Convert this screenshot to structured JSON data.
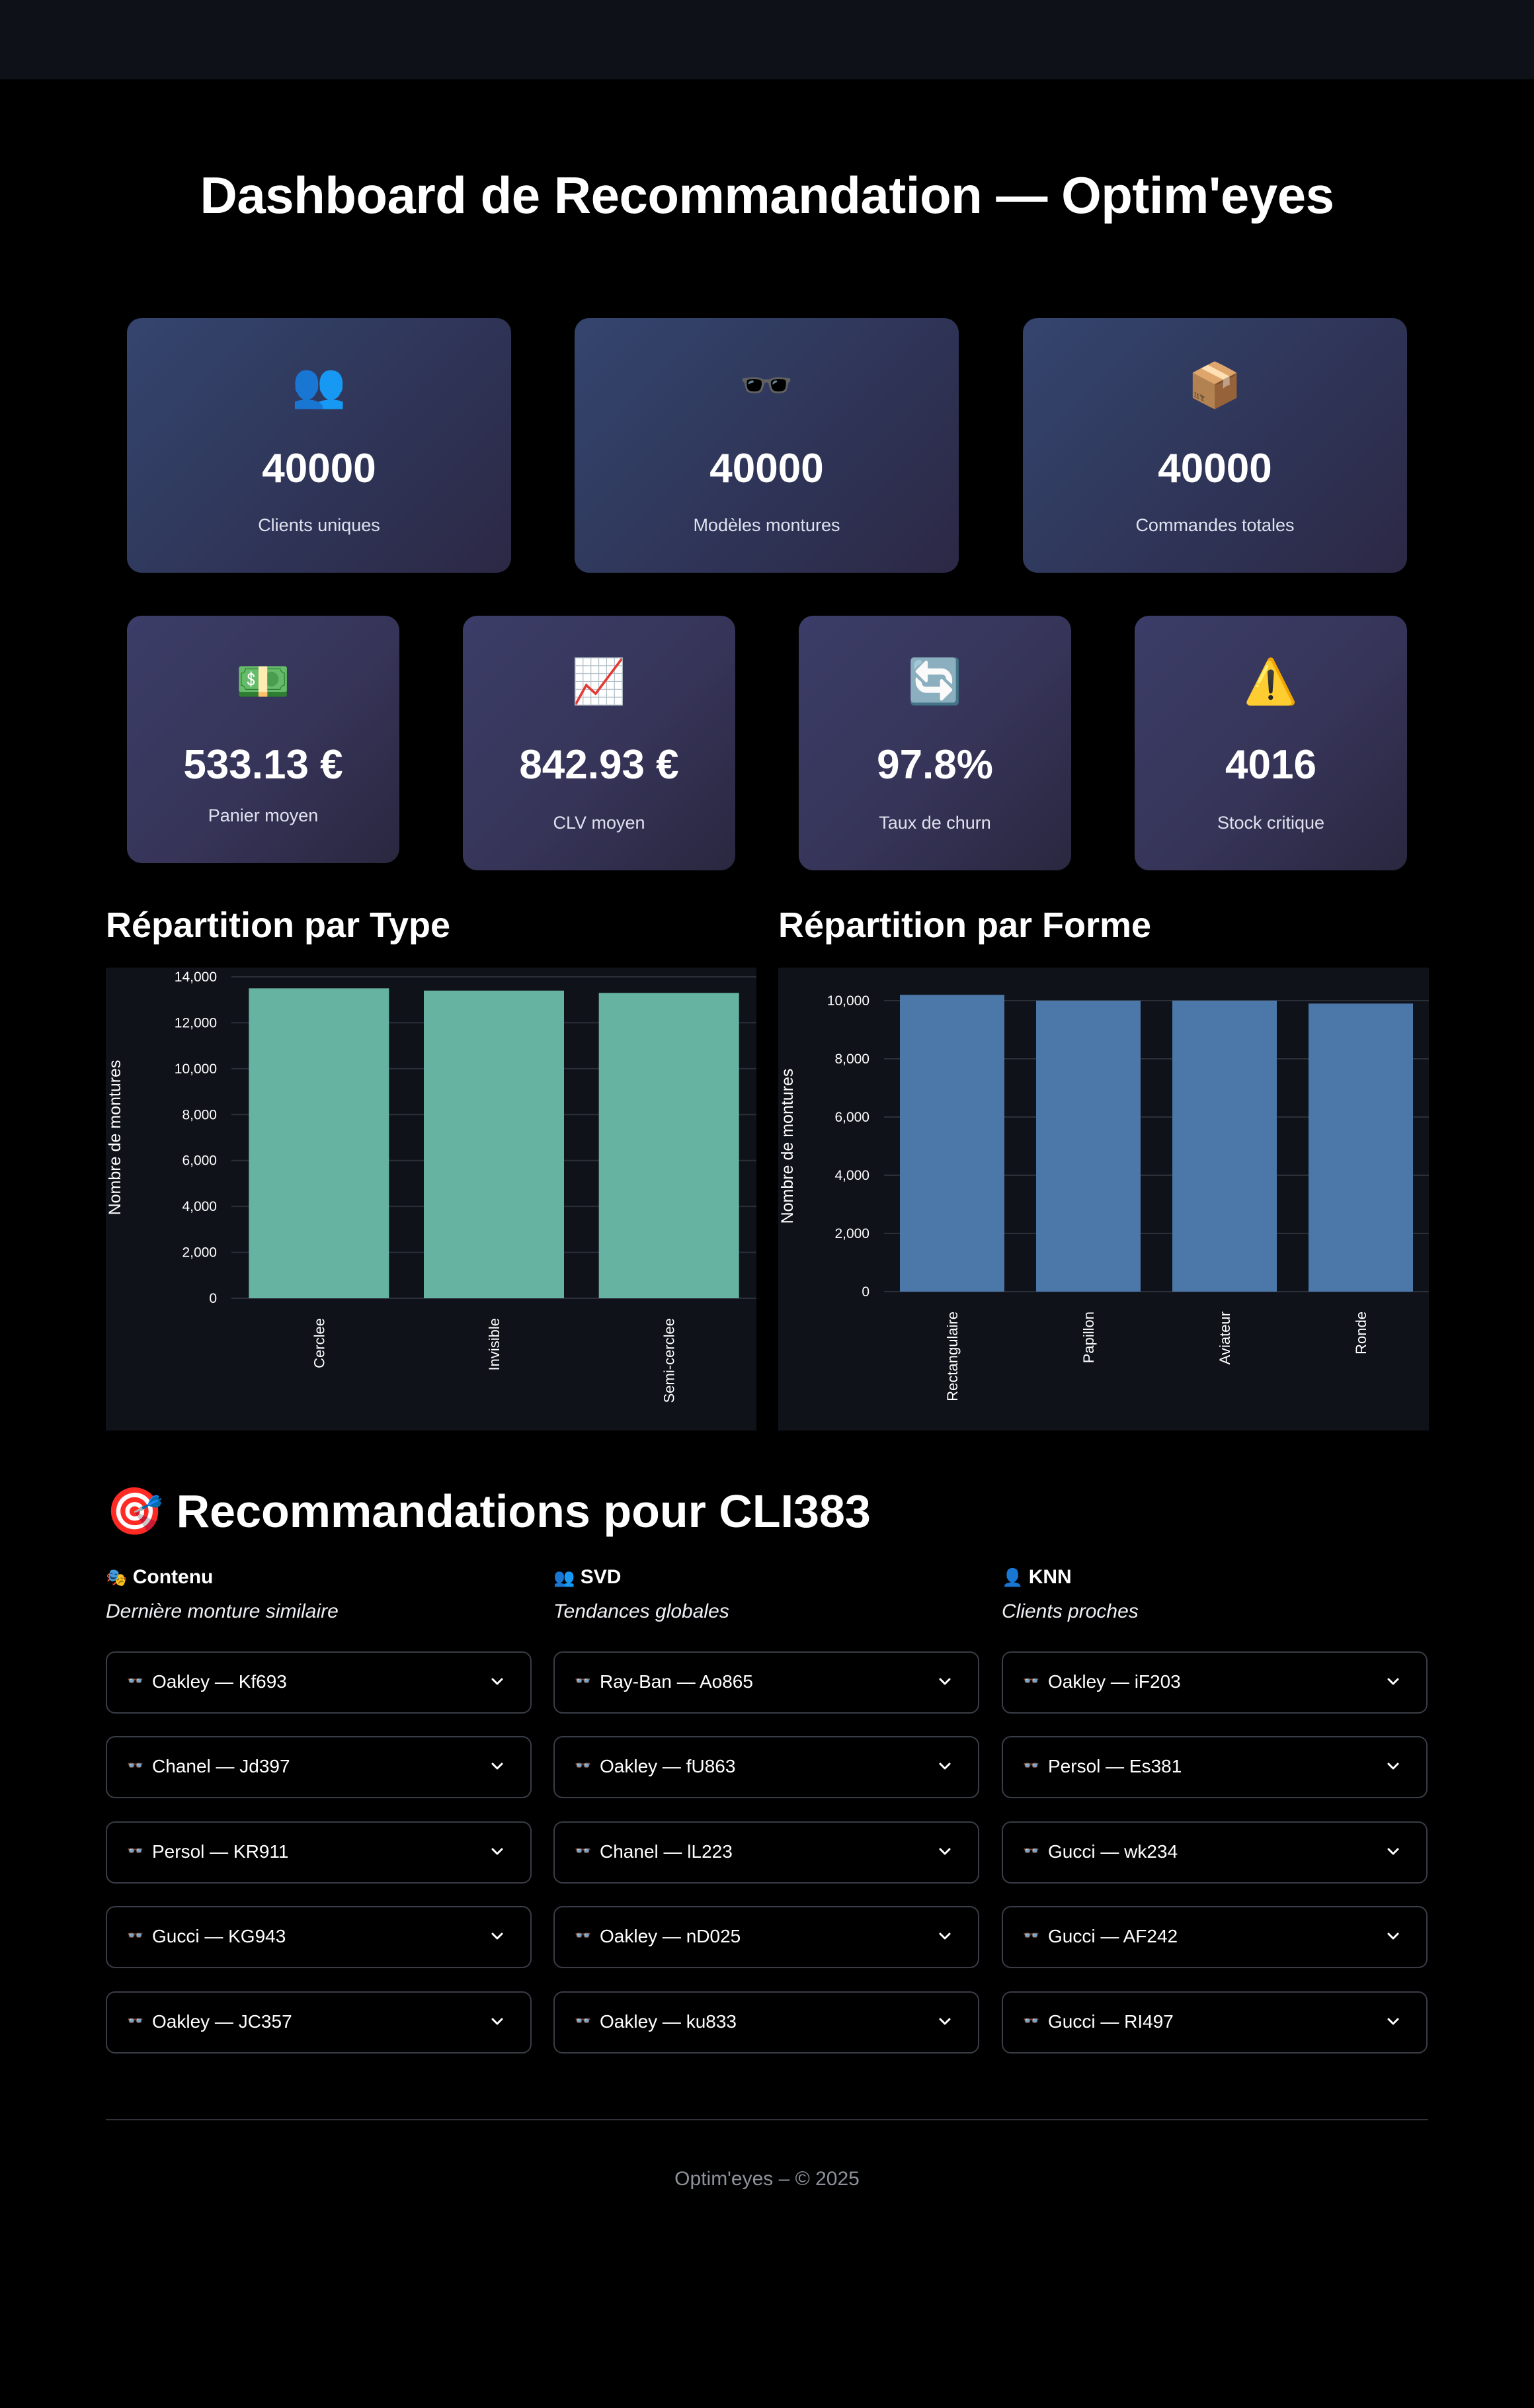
{
  "header": {
    "title": "Dashboard de Recommandation — Optim'eyes"
  },
  "kpis_row1": [
    {
      "icon": "👥",
      "icon_name": "users-icon",
      "value": "40000",
      "label": "Clients uniques"
    },
    {
      "icon": "🕶️",
      "icon_name": "sunglasses-icon",
      "value": "40000",
      "label": "Modèles montures"
    },
    {
      "icon": "📦",
      "icon_name": "package-icon",
      "value": "40000",
      "label": "Commandes totales"
    }
  ],
  "kpis_row2": [
    {
      "icon": "💵",
      "icon_name": "money-icon",
      "value": "533.13 €",
      "label": "Panier moyen"
    },
    {
      "icon": "📈",
      "icon_name": "chart-up-icon",
      "value": "842.93 €",
      "label": "CLV moyen"
    },
    {
      "icon": "🔄",
      "icon_name": "refresh-icon",
      "value": "97.8%",
      "label": "Taux de churn"
    },
    {
      "icon": "⚠️",
      "icon_name": "warning-icon",
      "value": "4016",
      "label": "Stock critique"
    }
  ],
  "charts_titles": {
    "type": "Répartition par Type",
    "forme": "Répartition par Forme"
  },
  "chart_data": [
    {
      "type": "bar",
      "title": "Répartition par Type",
      "categories": [
        "Cerclee",
        "Invisible",
        "Semi-cerclee"
      ],
      "values": [
        13500,
        13400,
        13300
      ],
      "xlabel": "",
      "ylabel": "Nombre de montures",
      "ylim": [
        0,
        14000
      ],
      "ticks": [
        0,
        2000,
        4000,
        6000,
        8000,
        10000,
        12000,
        14000
      ],
      "tick_labels": [
        "0",
        "2,000",
        "4,000",
        "6,000",
        "8,000",
        "10,000",
        "12,000",
        "14,000"
      ],
      "color": "#67b3a1",
      "grid": true
    },
    {
      "type": "bar",
      "title": "Répartition par Forme",
      "categories": [
        "Rectangulaire",
        "Papillon",
        "Aviateur",
        "Ronde"
      ],
      "values": [
        10200,
        10000,
        10000,
        9900
      ],
      "xlabel": "",
      "ylabel": "Nombre de montures",
      "ylim": [
        0,
        10000
      ],
      "ticks": [
        0,
        2000,
        4000,
        6000,
        8000,
        10000
      ],
      "tick_labels": [
        "0",
        "2,000",
        "4,000",
        "6,000",
        "8,000",
        "10,000"
      ],
      "color": "#4c77a9",
      "grid": true
    }
  ],
  "recommendations": {
    "icon": "🎯",
    "title": "Recommandations pour CLI383",
    "columns": [
      {
        "icon": "🎭",
        "icon_name": "masks-icon",
        "title": "Contenu",
        "subtitle": "Dernière monture similaire",
        "items": [
          "Oakley — Kf693",
          "Chanel — Jd397",
          "Persol — KR911",
          "Gucci — KG943",
          "Oakley — JC357"
        ]
      },
      {
        "icon": "👥",
        "icon_name": "users-icon",
        "title": "SVD",
        "subtitle": "Tendances globales",
        "items": [
          "Ray-Ban — Ao865",
          "Oakley — fU863",
          "Chanel — lL223",
          "Oakley — nD025",
          "Oakley — ku833"
        ]
      },
      {
        "icon": "👤",
        "icon_name": "user-icon",
        "title": "KNN",
        "subtitle": "Clients proches",
        "items": [
          "Oakley — iF203",
          "Persol — Es381",
          "Gucci — wk234",
          "Gucci — AF242",
          "Gucci — RI497"
        ]
      }
    ],
    "item_icon": "👓"
  },
  "footer": {
    "text": "Optim'eyes – © 2025"
  },
  "colors": {
    "card_top": "#34456e",
    "card_bottom": "#2c2845",
    "bar_type": "#67b3a1",
    "bar_forme": "#4c77a9"
  }
}
